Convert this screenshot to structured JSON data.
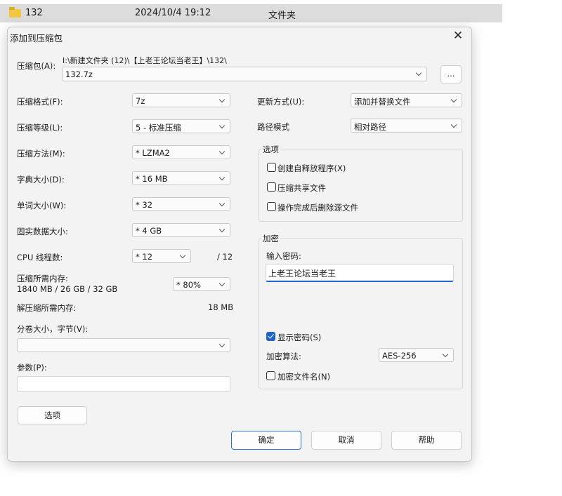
{
  "explorer": {
    "folder_name": "132",
    "modified": "2024/10/4 19:12",
    "type": "文件夹"
  },
  "dialog": {
    "title": "添加到压缩包",
    "archive_label": "压缩包(A):",
    "archive_path": "I:\\新建文件夹 (12)\\【上老王论坛当老王】\\132\\",
    "archive_name": "132.7z",
    "browse_label": "...",
    "format_label": "压缩格式(F):",
    "format_value": "7z",
    "level_label": "压缩等级(L):",
    "level_value": "5 - 标准压缩",
    "method_label": "压缩方法(M):",
    "method_value": "* LZMA2",
    "dict_label": "字典大小(D):",
    "dict_value": "* 16 MB",
    "word_label": "单词大小(W):",
    "word_value": "* 32",
    "solid_label": "固实数据大小:",
    "solid_value": "* 4 GB",
    "cpu_label": "CPU 线程数:",
    "cpu_value": "* 12",
    "cpu_total": "/ 12",
    "mem_label": "压缩所需内存:",
    "mem_detail": "1840 MB / 26 GB / 32 GB",
    "mem_value": "* 80%",
    "decomp_label": "解压缩所需内存:",
    "decomp_value": "18 MB",
    "volume_label": "分卷大小，字节(V):",
    "volume_value": "",
    "params_label": "参数(P):",
    "params_value": "",
    "options_button": "选项",
    "update_label": "更新方式(U):",
    "update_value": "添加并替换文件",
    "path_label": "路径模式",
    "path_value": "相对路径",
    "options_group": "选项",
    "opt_sfx": "创建自释放程序(X)",
    "opt_shared": "压缩共享文件",
    "opt_delete": "操作完成后删除源文件",
    "encrypt_group": "加密",
    "password_label": "输入密码:",
    "password_value": "上老王论坛当老王",
    "show_password": "显示密码(S)",
    "enc_method_label": "加密算法:",
    "enc_method_value": "AES-256",
    "encrypt_names": "加密文件名(N)",
    "ok": "确定",
    "cancel": "取消",
    "help": "帮助"
  }
}
